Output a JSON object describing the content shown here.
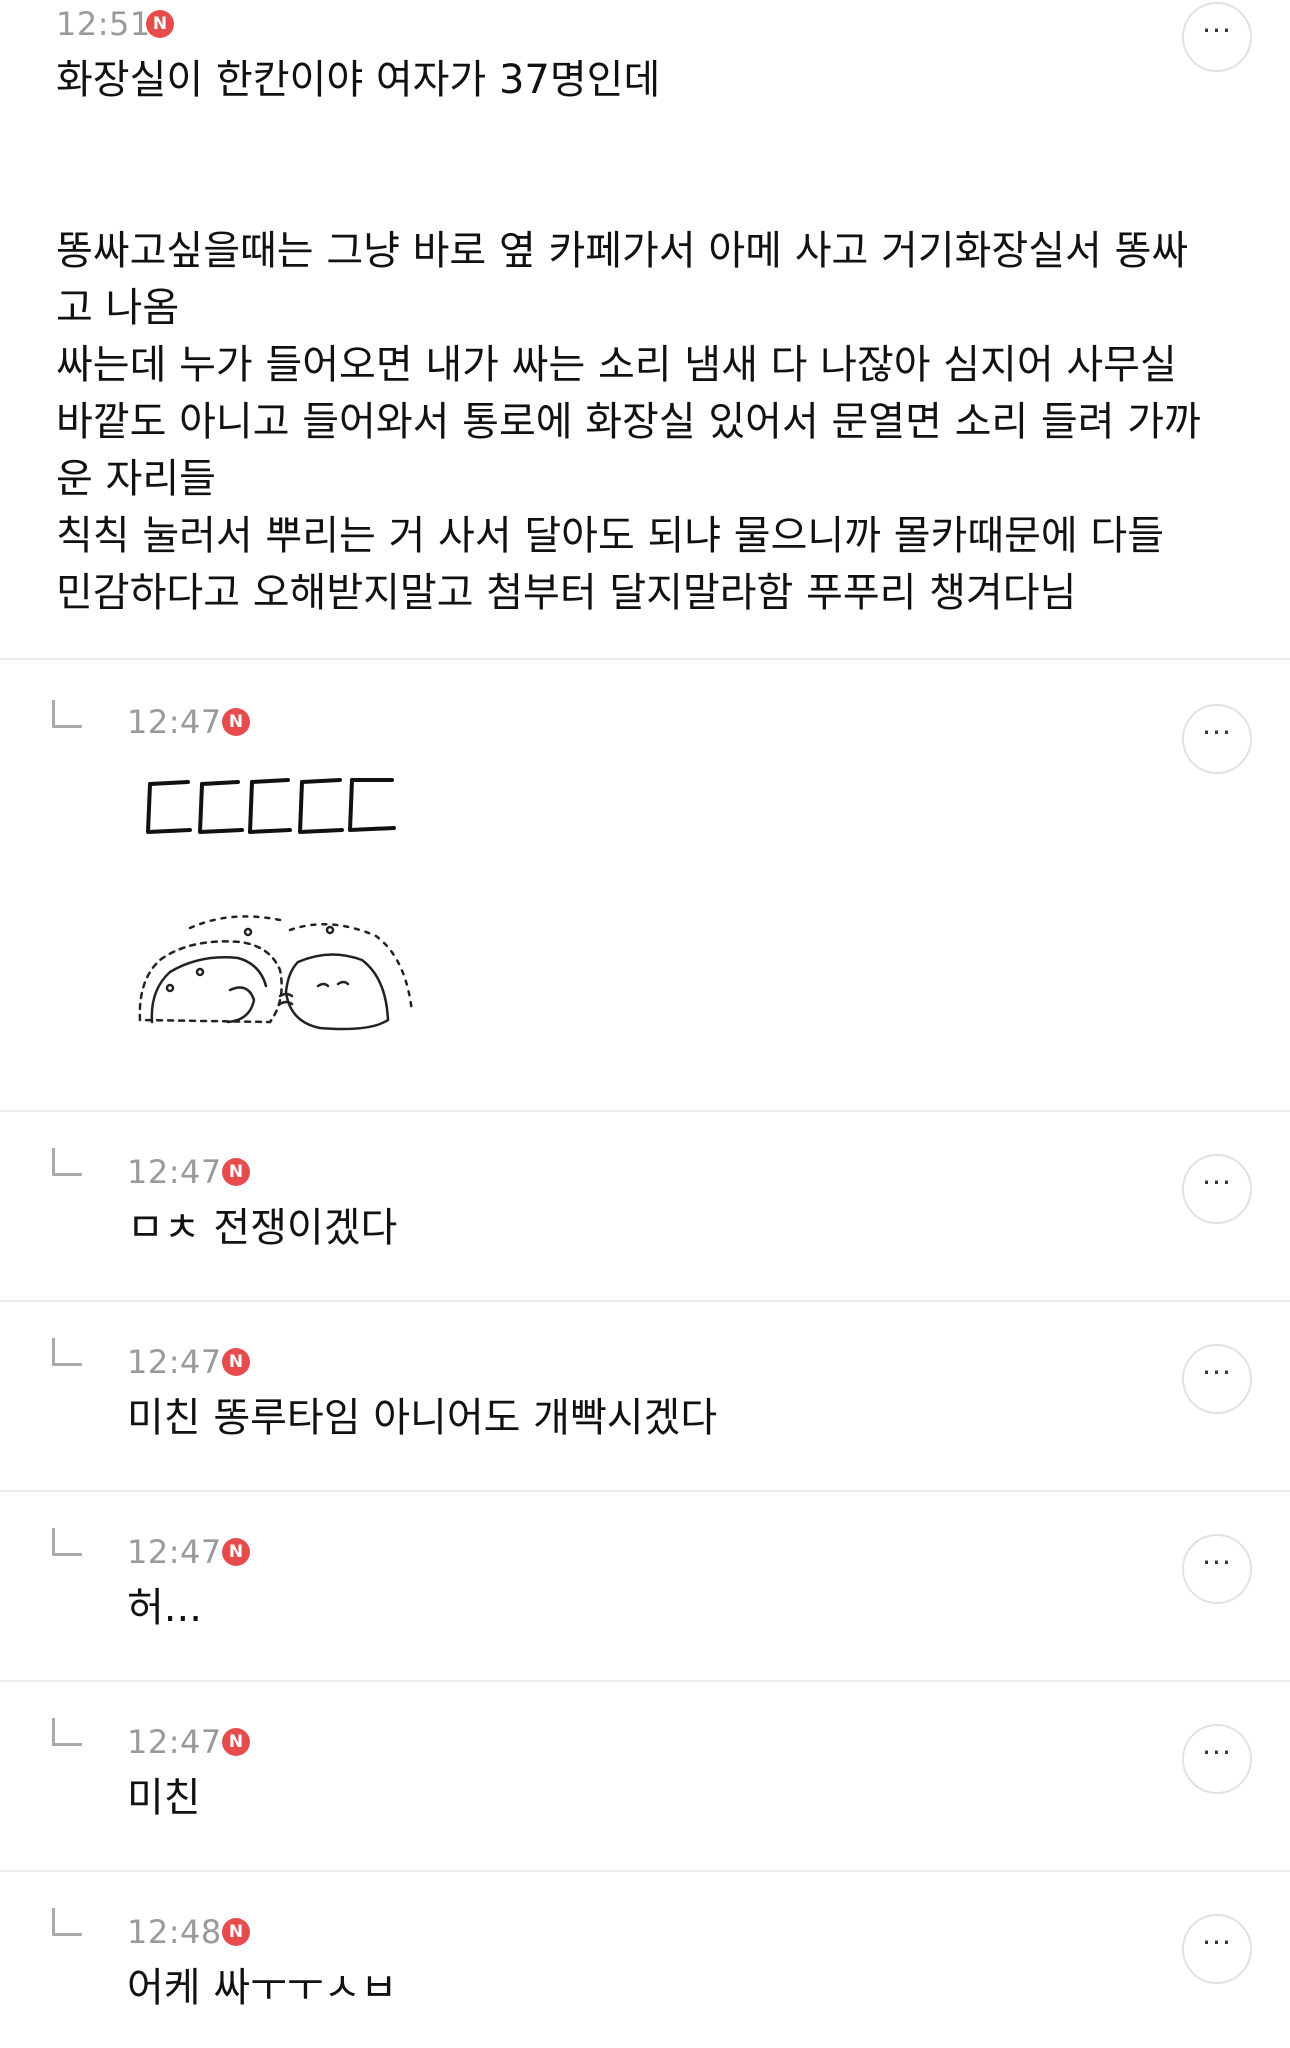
{
  "main_post": {
    "time": "12:51",
    "badge": "N",
    "text": "화장실이 한칸이야 여자가 37명인데\n\n\n똥싸고싶을때는 그냥 바로 옆 카페가서 아메 사고 거기화장실서 똥싸\n고 나옴\n싸는데 누가 들어오면 내가 싸는 소리 냄새 다 나잖아 심지어 사무실\n바깥도 아니고 들어와서 통로에 화장실 있어서 문열면 소리 들려 가까\n운 자리들\n칙칙 눌러서 뿌리는 거 사서 달아도 되냐 물으니까 몰카때문에 다들\n민감하다고 오해받지말고 첨부터 달지말라함 푸푸리 챙겨다님",
    "more_label": "···"
  },
  "replies": [
    {
      "time": "12:47",
      "badge": "N",
      "text": "",
      "sticker": "sticker-dccc-hamsters",
      "sticker_text": "ㄷㄷㄷㄷㄷ",
      "more_label": "···"
    },
    {
      "time": "12:47",
      "badge": "N",
      "text": "ㅁㅊ 전쟁이겠다",
      "more_label": "···"
    },
    {
      "time": "12:47",
      "badge": "N",
      "text": "미친 똥루타임 아니어도 개빡시겠다",
      "more_label": "···"
    },
    {
      "time": "12:47",
      "badge": "N",
      "text": "허...",
      "more_label": "···"
    },
    {
      "time": "12:47",
      "badge": "N",
      "text": "미친",
      "more_label": "···"
    },
    {
      "time": "12:48",
      "badge": "N",
      "text": "어케 싸ㅜㅜㅅㅂ",
      "more_label": "···"
    }
  ],
  "colors": {
    "badge": "#e64c4c",
    "time": "#9a9a9a",
    "divider": "#ebebeb",
    "text": "#111111"
  },
  "icons": {
    "reply": "reply-arrow-icon",
    "more": "more-dots-icon",
    "new": "new-badge-icon"
  }
}
